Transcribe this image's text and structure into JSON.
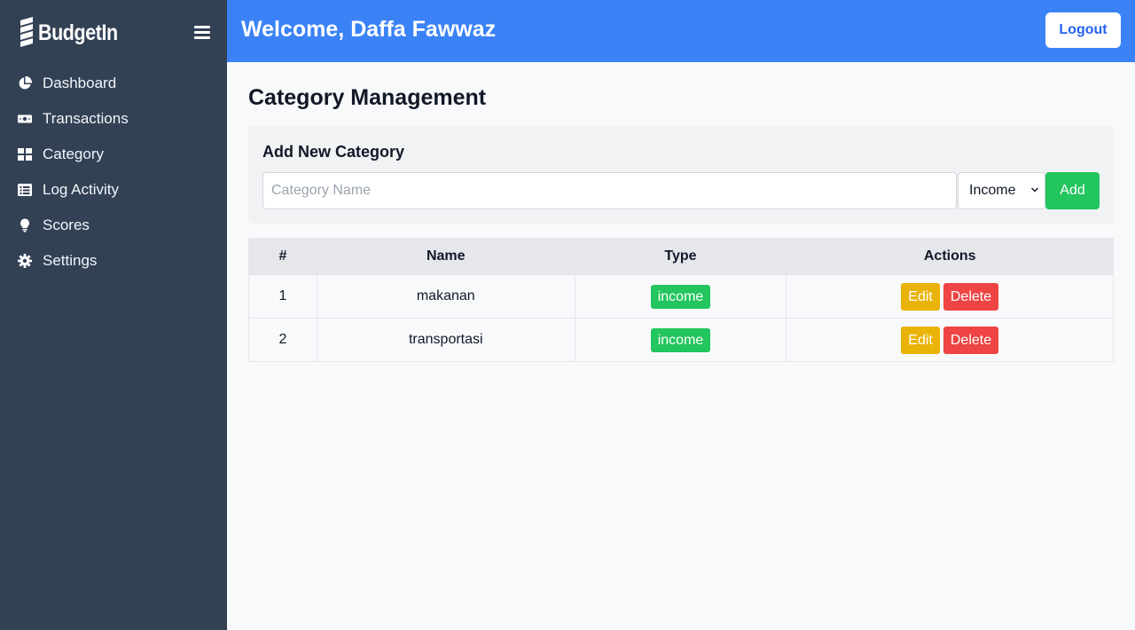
{
  "brand": {
    "name": "BudgetIn",
    "logo_icon": "stacked-s-logo"
  },
  "sidebar": {
    "toggle_icon": "hamburger-icon",
    "items": [
      {
        "label": "Dashboard",
        "icon": "pie-chart-icon"
      },
      {
        "label": "Transactions",
        "icon": "money-bill-icon"
      },
      {
        "label": "Category",
        "icon": "grid-icon"
      },
      {
        "label": "Log Activity",
        "icon": "list-icon"
      },
      {
        "label": "Scores",
        "icon": "lightbulb-icon"
      },
      {
        "label": "Settings",
        "icon": "gear-icon"
      }
    ]
  },
  "header": {
    "welcome": "Welcome, Daffa Fawwaz",
    "logout_label": "Logout"
  },
  "main": {
    "title": "Category Management",
    "add_form": {
      "title": "Add New Category",
      "name_placeholder": "Category Name",
      "name_value": "",
      "type_selected": "Income",
      "add_label": "Add"
    },
    "table": {
      "headers": [
        "#",
        "Name",
        "Type",
        "Actions"
      ],
      "rows": [
        {
          "num": "1",
          "name": "makanan",
          "type": "income",
          "edit": "Edit",
          "delete": "Delete"
        },
        {
          "num": "2",
          "name": "transportasi",
          "type": "income",
          "edit": "Edit",
          "delete": "Delete"
        }
      ]
    }
  },
  "colors": {
    "sidebar_bg": "#334155",
    "header_bg": "#3b82f6",
    "success": "#22c55e",
    "warning": "#eab308",
    "danger": "#ef4444"
  }
}
